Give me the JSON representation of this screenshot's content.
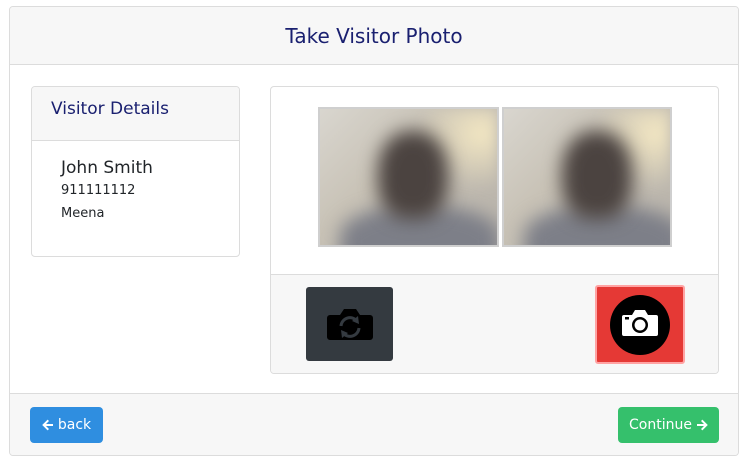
{
  "header": {
    "title": "Take Visitor Photo"
  },
  "visitor_details": {
    "title": "Visitor Details",
    "name": "John Smith",
    "phone": "911111112",
    "host": "Meena"
  },
  "camera": {
    "switch_icon": "camera-rotate-icon",
    "capture_icon": "camera-icon",
    "capture_color": "#e53935",
    "switch_color": "#343a40"
  },
  "footer": {
    "back_label": "back",
    "continue_label": "Continue",
    "back_color": "#2f8ee0",
    "continue_color": "#35c06c"
  }
}
